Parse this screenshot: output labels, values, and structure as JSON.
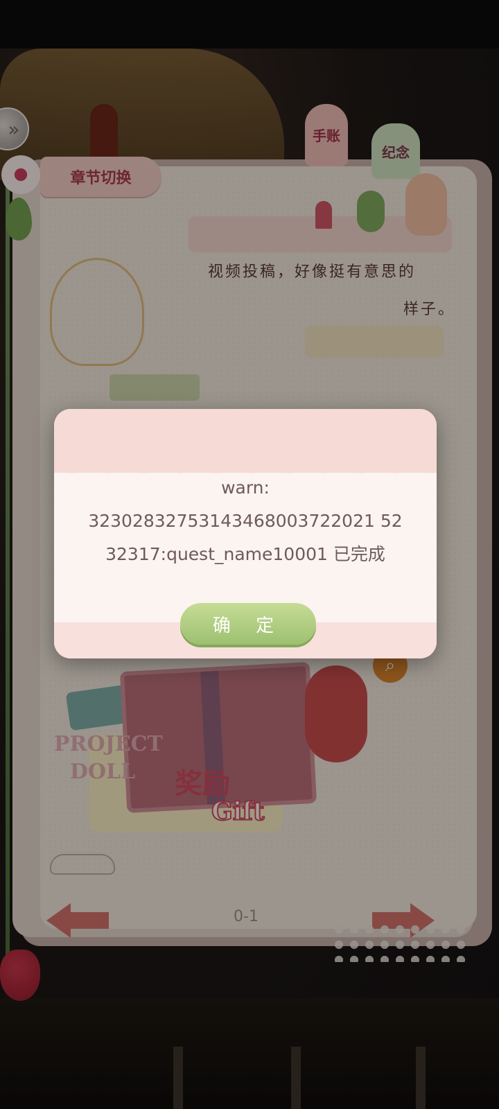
{
  "tabs": {
    "chapter_switch": "章节切换",
    "journal": "手账",
    "memorial": "纪念"
  },
  "story": {
    "line1": "视频投稿，好像挺有意思的",
    "line2": "样子。"
  },
  "reward_card": {
    "brand_line1": "PROJECT",
    "brand_line2": "DOLL",
    "reward_cn": "奖励",
    "reward_en": "Gift"
  },
  "pager": {
    "label": "0-1"
  },
  "dialog": {
    "line1": "warn:",
    "line2": "32302832753143468003722021 52",
    "line3": "32317:quest_name10001  已完成",
    "confirm_label": "确 定"
  },
  "icons": {
    "back": "double-chevron-right-icon",
    "search": "magnifier-icon",
    "prev": "left-arrow-icon",
    "next": "right-arrow-icon"
  }
}
